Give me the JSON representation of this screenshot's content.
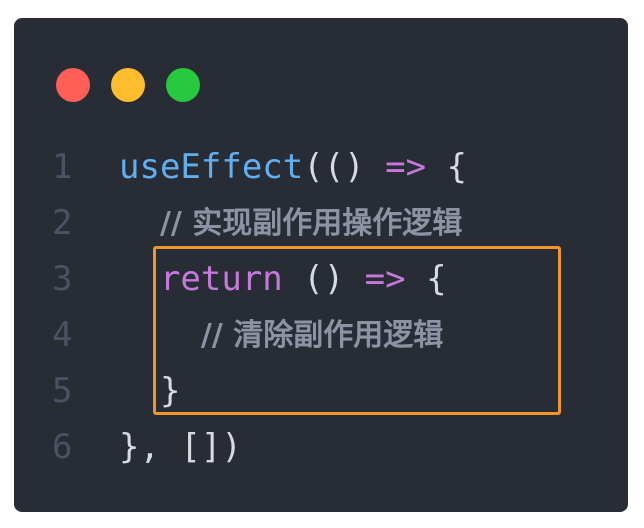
{
  "window": {
    "dots": [
      "close",
      "minimize",
      "maximize"
    ],
    "colors": {
      "background": "#282c34",
      "red": "#ff5f56",
      "yellow": "#ffbd2e",
      "green": "#27c93f",
      "highlight": "#f2952b"
    }
  },
  "code": {
    "lines": [
      {
        "number": "1",
        "indent": "",
        "tokens": [
          {
            "type": "fn",
            "text": "useEffect"
          },
          {
            "type": "plain",
            "text": "(() "
          },
          {
            "type": "op",
            "text": "=>"
          },
          {
            "type": "plain",
            "text": " {"
          }
        ]
      },
      {
        "number": "2",
        "indent": "  ",
        "tokens": [
          {
            "type": "comment",
            "text": "// 实现副作用操作逻辑"
          }
        ]
      },
      {
        "number": "3",
        "indent": "  ",
        "tokens": [
          {
            "type": "kw",
            "text": "return"
          },
          {
            "type": "plain",
            "text": " () "
          },
          {
            "type": "op",
            "text": "=>"
          },
          {
            "type": "plain",
            "text": " {"
          }
        ]
      },
      {
        "number": "4",
        "indent": "    ",
        "tokens": [
          {
            "type": "comment",
            "text": "// 清除副作用逻辑"
          }
        ]
      },
      {
        "number": "5",
        "indent": "  ",
        "tokens": [
          {
            "type": "plain",
            "text": "}"
          }
        ]
      },
      {
        "number": "6",
        "indent": "",
        "tokens": [
          {
            "type": "plain",
            "text": "}, [])"
          }
        ]
      }
    ]
  }
}
